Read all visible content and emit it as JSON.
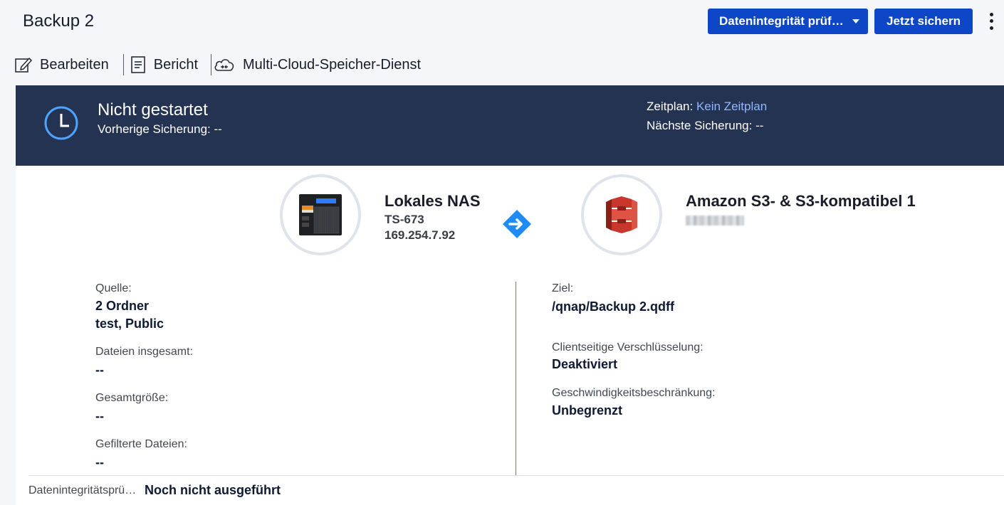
{
  "header": {
    "title": "Backup 2",
    "integrity_button": "Datenintegrität prüf…",
    "backup_now_button": "Jetzt sichern"
  },
  "toolbar": {
    "edit": "Bearbeiten",
    "report": "Bericht",
    "multicloud": "Multi-Cloud-Speicher-Dienst"
  },
  "status": {
    "title": "Nicht gestartet",
    "previous": "Vorherige Sicherung: --",
    "schedule_label": "Zeitplan:",
    "schedule_value": "Kein Zeitplan",
    "next": "Nächste Sicherung: --"
  },
  "source_device": {
    "name": "Lokales NAS",
    "model": "TS-673",
    "ip": "169.254.7.92"
  },
  "target_device": {
    "name": "Amazon S3- & S3-kompatibel 1"
  },
  "details_left": {
    "source_label": "Quelle:",
    "source_count": "2 Ordner",
    "source_folders": "test, Public",
    "files_label": "Dateien insgesamt:",
    "files_value": "--",
    "size_label": "Gesamtgröße:",
    "size_value": "--",
    "filtered_label": "Gefilterte Dateien:",
    "filtered_value": "--"
  },
  "details_right": {
    "target_label": "Ziel:",
    "target_value": "/qnap/Backup 2.qdff",
    "encryption_label": "Clientseitige Verschlüsselung:",
    "encryption_value": "Deaktiviert",
    "speed_label": "Geschwindigkeitsbeschränkung:",
    "speed_value": "Unbegrenzt"
  },
  "footer": {
    "integrity_label": "Datenintegritätsprü…",
    "integrity_value": "Noch nicht ausgeführt"
  },
  "colors": {
    "primary": "#0d47c7",
    "banner": "#253352",
    "link": "#8fb8ff",
    "aws": "#c9372c"
  }
}
